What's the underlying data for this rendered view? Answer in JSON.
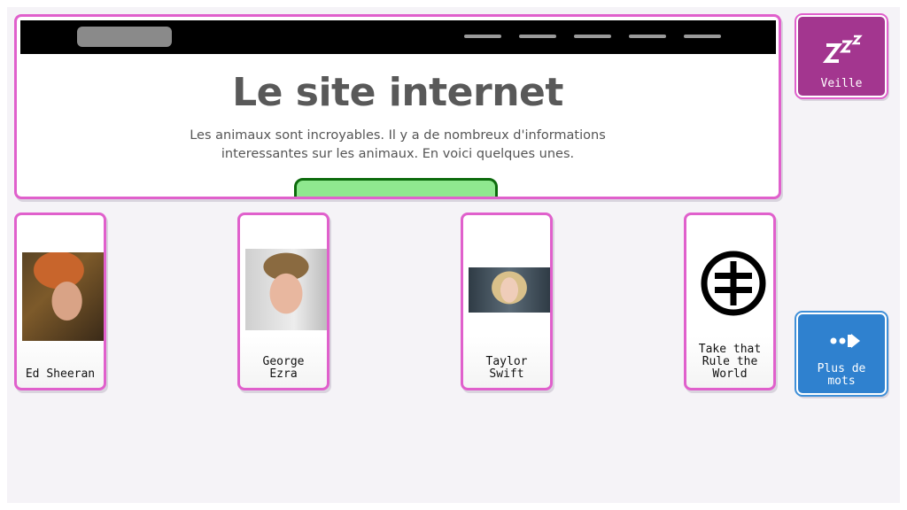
{
  "website": {
    "title": "Le site internet",
    "description": "Les animaux sont incroyables. Il y a de nombreux d'informations interessantes sur les animaux. En voici quelques unes."
  },
  "tiles": [
    {
      "label": "Ed Sheeran"
    },
    {
      "label": "George\nEzra"
    },
    {
      "label": "Taylor\nSwift"
    },
    {
      "label": "Take that\nRule the\nWorld"
    }
  ],
  "actions": {
    "sleep": {
      "label": "Veille",
      "icon": "zzz-sleep-icon"
    },
    "more_words": {
      "label": "Plus de\nmots",
      "icon": "dots-arrow-right-icon"
    }
  },
  "colors": {
    "tile_border": "#e060cc",
    "sleep_button": "#a3368f",
    "more_button": "#2f81cf",
    "cta_fill": "#8fe88f",
    "cta_border": "#0d6b0d"
  }
}
